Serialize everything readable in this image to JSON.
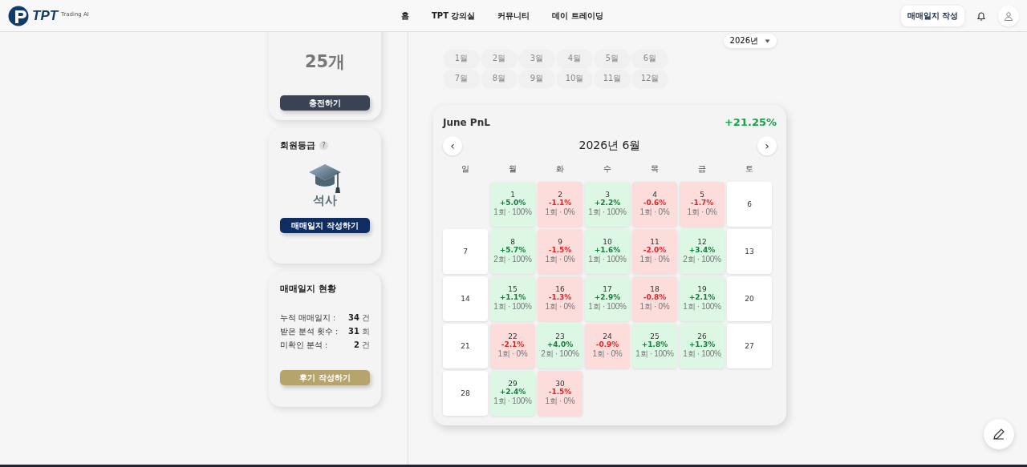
{
  "header": {
    "logo": "TPT",
    "logo_sub": "Trading AI",
    "nav": [
      {
        "label": "홈"
      },
      {
        "label": "TPT 강의실"
      },
      {
        "label": "커뮤니티"
      },
      {
        "label": "데이 트레이딩"
      }
    ],
    "write_button": "매매일지 작성"
  },
  "sidebar": {
    "credits": {
      "value": "25개",
      "button": "충전하기"
    },
    "grade": {
      "title": "회원등급",
      "help": "?",
      "grade": "석사",
      "button": "매매일지 작성하기"
    },
    "status": {
      "title": "매매일지 현황",
      "rows": [
        {
          "label": "누적 매매일지 :",
          "value": "34",
          "unit": "건"
        },
        {
          "label": "받은 분석 횟수 :",
          "value": "31",
          "unit": "회"
        },
        {
          "label": "미확인 분석 :",
          "value": "2",
          "unit": "건"
        }
      ],
      "button": "후기 작성하기"
    }
  },
  "period": {
    "year": "2026년",
    "months": [
      {
        "label": "1월",
        "selected": false
      },
      {
        "label": "2월",
        "selected": false
      },
      {
        "label": "3월",
        "selected": false
      },
      {
        "label": "4월",
        "selected": false
      },
      {
        "label": "5월",
        "selected": false
      },
      {
        "label": "6월",
        "selected": false
      },
      {
        "label": "7월",
        "selected": false
      },
      {
        "label": "8월",
        "selected": false
      },
      {
        "label": "9월",
        "selected": false
      },
      {
        "label": "10월",
        "selected": false
      },
      {
        "label": "11월",
        "selected": false
      },
      {
        "label": "12월",
        "selected": false
      }
    ]
  },
  "calendar": {
    "title": "June PnL",
    "total": "+21.25%",
    "month": "2026년 6월",
    "prev": "‹",
    "next": "›",
    "weekdays": [
      "일",
      "월",
      "화",
      "수",
      "목",
      "금",
      "토"
    ],
    "weeks": [
      [
        {
          "kind": "empty"
        },
        {
          "kind": "gain",
          "day": "1",
          "pnl": "+5.0%",
          "stats": "1회 · 100%"
        },
        {
          "kind": "loss",
          "day": "2",
          "pnl": "-1.1%",
          "stats": "1회 · 0%"
        },
        {
          "kind": "gain",
          "day": "3",
          "pnl": "+2.2%",
          "stats": "1회 · 100%"
        },
        {
          "kind": "loss",
          "day": "4",
          "pnl": "-0.6%",
          "stats": "1회 · 0%"
        },
        {
          "kind": "loss",
          "day": "5",
          "pnl": "-1.7%",
          "stats": "1회 · 0%"
        },
        {
          "kind": "plain",
          "day": "6"
        }
      ],
      [
        {
          "kind": "plain",
          "day": "7"
        },
        {
          "kind": "gain",
          "day": "8",
          "pnl": "+5.7%",
          "stats": "2회 · 100%"
        },
        {
          "kind": "loss",
          "day": "9",
          "pnl": "-1.5%",
          "stats": "1회 · 0%"
        },
        {
          "kind": "gain",
          "day": "10",
          "pnl": "+1.6%",
          "stats": "1회 · 100%"
        },
        {
          "kind": "loss",
          "day": "11",
          "pnl": "-2.0%",
          "stats": "1회 · 0%"
        },
        {
          "kind": "gain",
          "day": "12",
          "pnl": "+3.4%",
          "stats": "2회 · 100%"
        },
        {
          "kind": "plain",
          "day": "13"
        }
      ],
      [
        {
          "kind": "plain",
          "day": "14"
        },
        {
          "kind": "gain",
          "day": "15",
          "pnl": "+1.1%",
          "stats": "1회 · 100%"
        },
        {
          "kind": "loss",
          "day": "16",
          "pnl": "-1.3%",
          "stats": "1회 · 0%"
        },
        {
          "kind": "gain",
          "day": "17",
          "pnl": "+2.9%",
          "stats": "1회 · 100%"
        },
        {
          "kind": "loss",
          "day": "18",
          "pnl": "-0.8%",
          "stats": "1회 · 0%"
        },
        {
          "kind": "gain",
          "day": "19",
          "pnl": "+2.1%",
          "stats": "1회 · 100%"
        },
        {
          "kind": "plain",
          "day": "20"
        }
      ],
      [
        {
          "kind": "plain",
          "day": "21"
        },
        {
          "kind": "loss",
          "day": "22",
          "pnl": "-2.1%",
          "stats": "1회 · 0%"
        },
        {
          "kind": "gain",
          "day": "23",
          "pnl": "+4.0%",
          "stats": "2회 · 100%"
        },
        {
          "kind": "loss",
          "day": "24",
          "pnl": "-0.9%",
          "stats": "1회 · 0%"
        },
        {
          "kind": "gain",
          "day": "25",
          "pnl": "+1.8%",
          "stats": "1회 · 100%"
        },
        {
          "kind": "gain",
          "day": "26",
          "pnl": "+1.3%",
          "stats": "1회 · 100%"
        },
        {
          "kind": "plain",
          "day": "27"
        }
      ],
      [
        {
          "kind": "plain",
          "day": "28"
        },
        {
          "kind": "gain",
          "day": "29",
          "pnl": "+2.4%",
          "stats": "1회 · 100%"
        },
        {
          "kind": "loss",
          "day": "30",
          "pnl": "-1.5%",
          "stats": "1회 · 0%"
        }
      ]
    ]
  }
}
